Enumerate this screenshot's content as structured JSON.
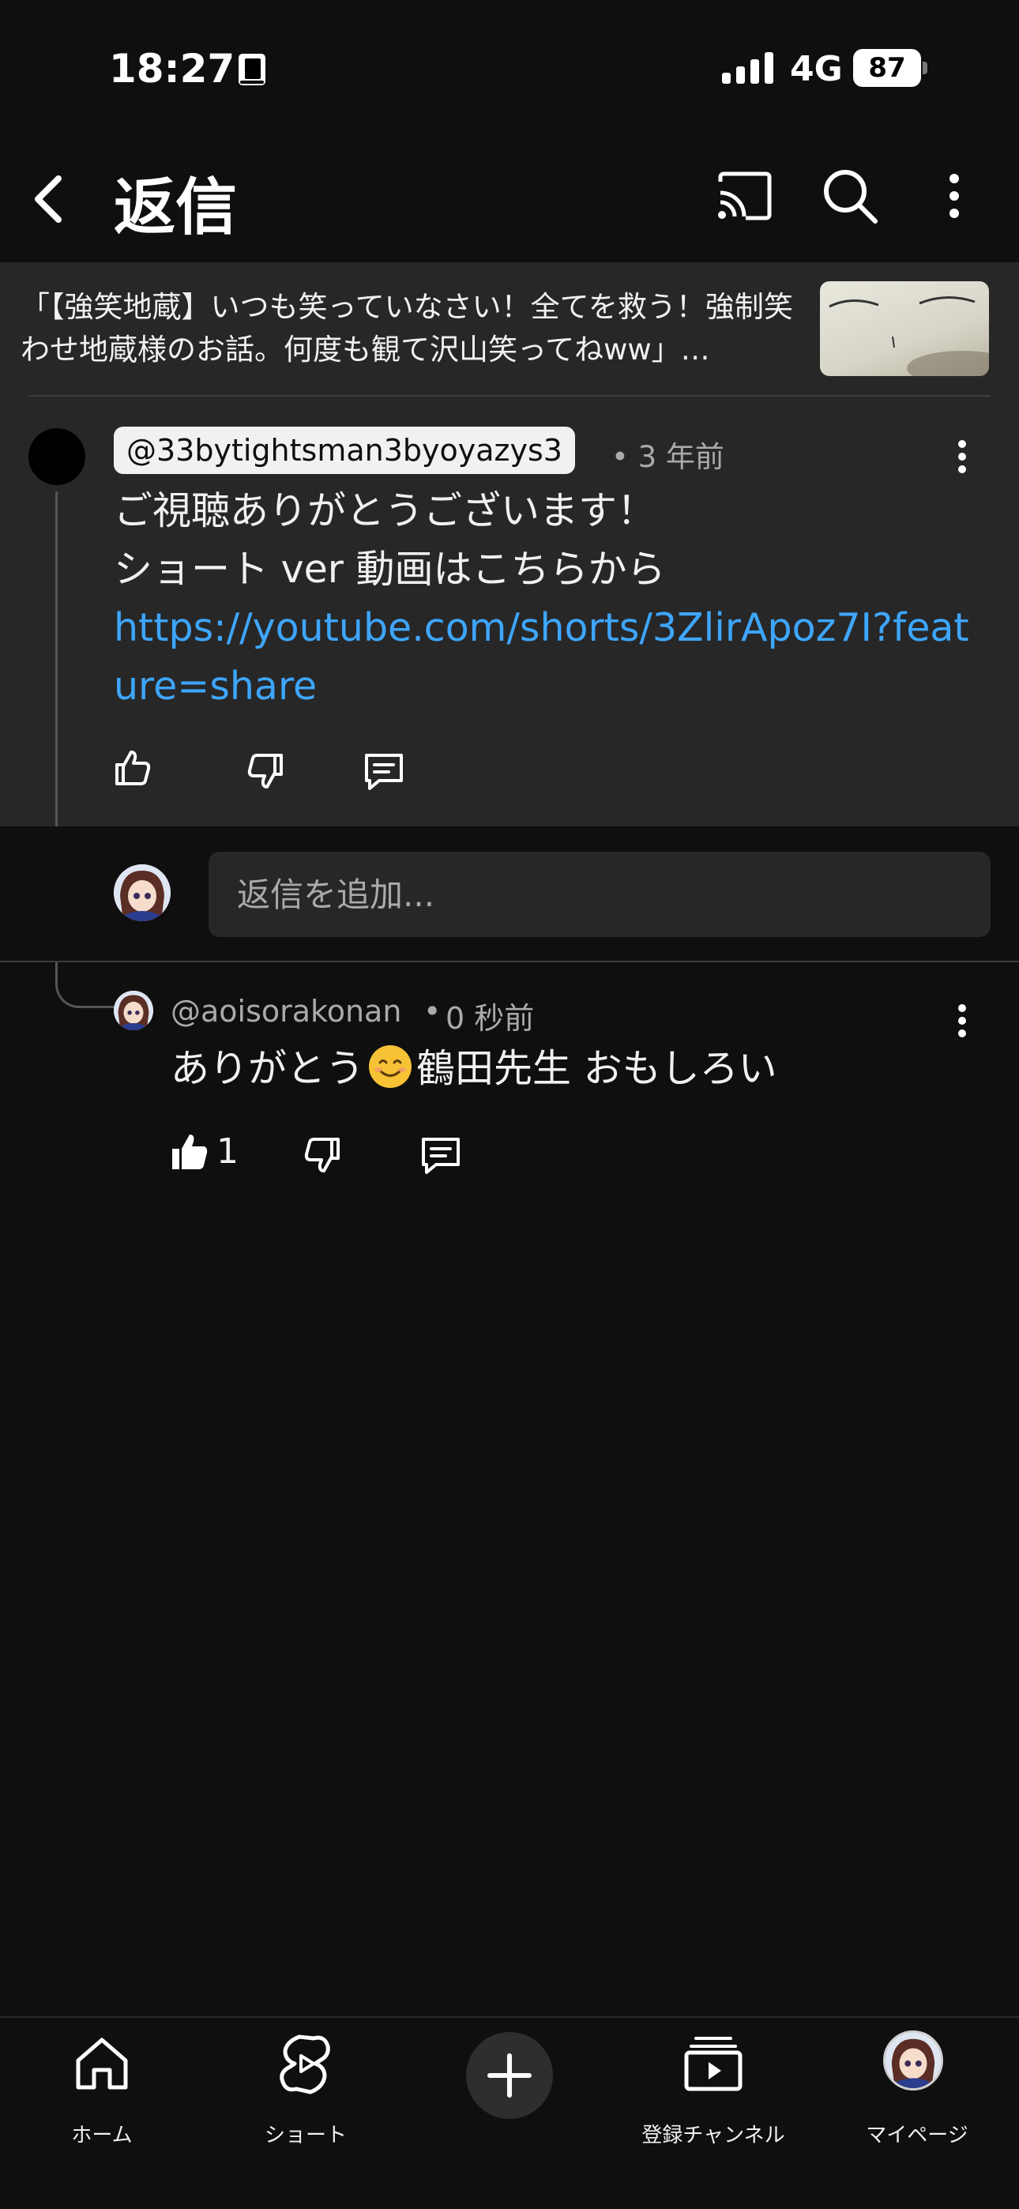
{
  "status_bar": {
    "time": "18:27",
    "network": "4G",
    "battery": "87"
  },
  "header": {
    "title": "返信",
    "icons": [
      "back-icon",
      "cast-icon",
      "search-icon",
      "more-icon"
    ]
  },
  "video": {
    "title": "「【強笑地蔵】いつも笑っていなさい！全てを救う！強制笑わせ地蔵様のお話。何度も観て沢山笑ってねww」…"
  },
  "parent_comment": {
    "handle": "@33bytightsman3byoyazys3",
    "time": "• 3 年前",
    "line1": "ご視聴ありがとうございます！",
    "line2": "ショート ver 動画はこちらから",
    "link": "https://youtube.com/shorts/3ZlirApoz7I?feature=share"
  },
  "reply_box": {
    "placeholder": "返信を追加..."
  },
  "reply": {
    "handle": "@aoisorakonan",
    "dot": "•",
    "time": "0 秒前",
    "text_before": "ありがとう",
    "text_after": "鶴田先生 おもしろい",
    "likes": "1"
  },
  "bottom_nav": {
    "home": "ホーム",
    "shorts": "ショート",
    "subscriptions": "登録チャンネル",
    "mypage": "マイページ"
  },
  "colors": {
    "background": "#0f0f0f",
    "surface": "#272727",
    "link": "#3ea6ff",
    "secondary_text": "#aaaaaa"
  }
}
